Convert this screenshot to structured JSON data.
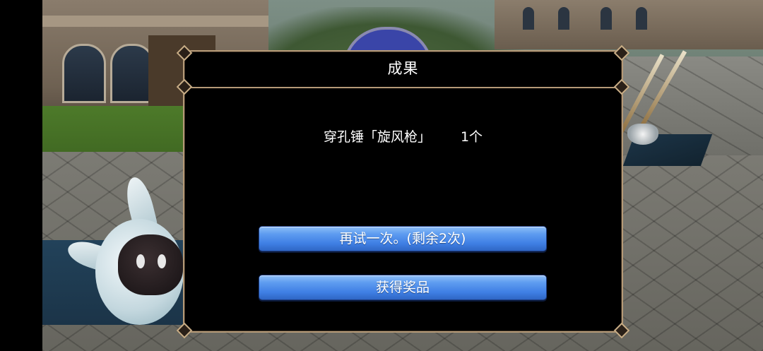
{
  "dialog": {
    "title": "成果",
    "reward": {
      "item_name": "穿孔锤「旋风枪」",
      "quantity": "1个"
    },
    "buttons": {
      "retry_label": "再试一次。(剩余2次)",
      "claim_label": "获得奖品"
    }
  },
  "colors": {
    "frame_border": "#b59a78",
    "button_blue": "#3f7fe4",
    "dialog_bg": "#000000",
    "text": "#ffffff"
  }
}
